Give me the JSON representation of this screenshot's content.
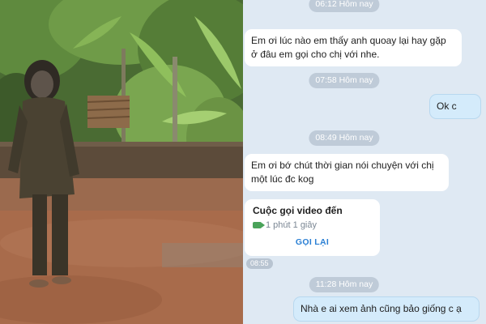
{
  "chat": {
    "messages": [
      {
        "kind": "timestamp",
        "text": "06:12 Hôm nay"
      },
      {
        "kind": "incoming",
        "text": "Em ơi lúc nào em thấy anh quoay lại  hay gặp\nở đâu em gọi cho chị   với nhe."
      },
      {
        "kind": "timestamp",
        "text": "07:58 Hôm nay"
      },
      {
        "kind": "outgoing",
        "text": "Ok c"
      },
      {
        "kind": "timestamp",
        "text": "08:49 Hôm nay"
      },
      {
        "kind": "incoming",
        "text": "Em ơi bớ chút thời gian nói chuyện với chị\nmột lúc đc kog"
      },
      {
        "kind": "timestamp",
        "text": "11:28 Hôm nay"
      },
      {
        "kind": "outgoing",
        "text": "Nhà e ai xem ảnh cũng bảo giống c ạ"
      }
    ],
    "call": {
      "title": "Cuộc gọi video đến",
      "duration": "1 phút 1 giây",
      "action": "GỌI LẠI",
      "time": "08:55"
    }
  },
  "photo": {
    "description_icon": "person-photo"
  },
  "colors": {
    "chat_background": "#dfe9f3",
    "outgoing_bubble": "#d4ebfb",
    "incoming_bubble": "#ffffff",
    "timestamp_pill": "#bfcbd8",
    "callback_link": "#2a7fd4"
  }
}
